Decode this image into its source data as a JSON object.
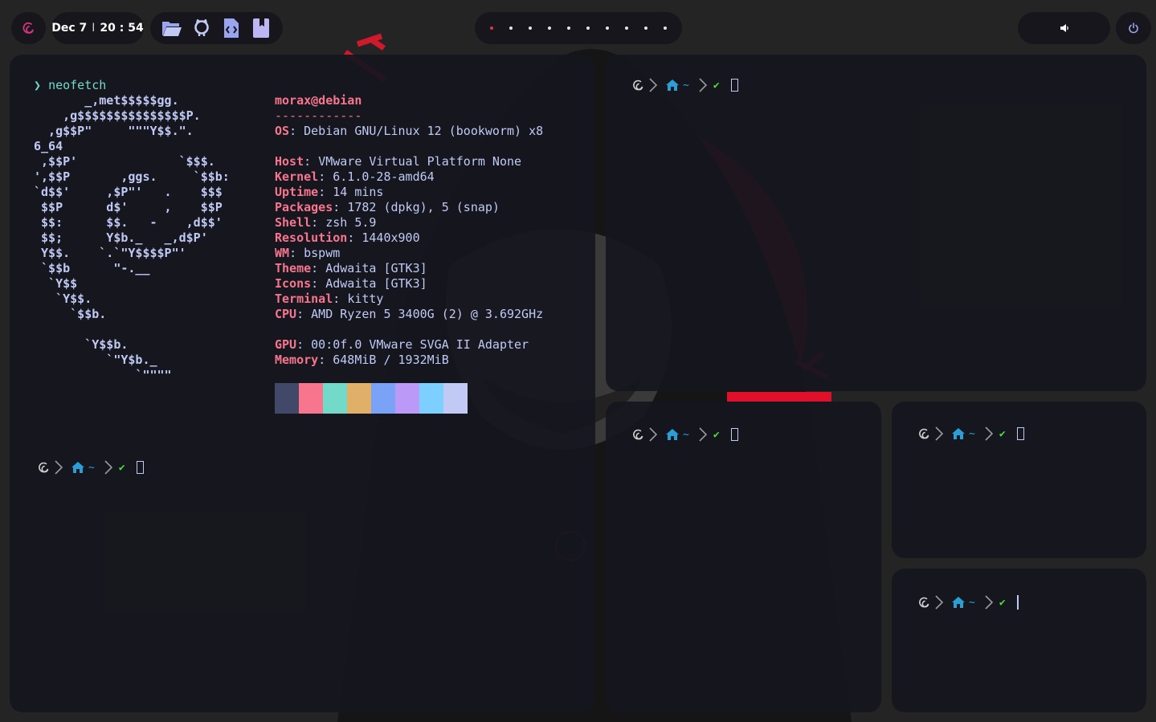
{
  "colors": {
    "accent": "#e0334e",
    "term_fg": "#c0caf5",
    "term_key": "#f7768e",
    "prompt_arrow": "#73daca",
    "home_blue": "#2a9fd6",
    "check_green": "#4ade39"
  },
  "topbar": {
    "logo_icon": "debian-swirl-icon",
    "clock": {
      "date": "Dec 7",
      "separator": "I",
      "time": "20 : 54"
    },
    "apps": [
      {
        "name": "file-manager",
        "icon": "folder-open-icon"
      },
      {
        "name": "github",
        "icon": "github-icon"
      },
      {
        "name": "code-editor",
        "icon": "code-file-icon"
      },
      {
        "name": "notes",
        "icon": "bookmark-icon"
      }
    ],
    "workspaces": {
      "count": 10,
      "active_index": 0
    },
    "volume_icon": "speaker-icon",
    "power_icon": "power-icon"
  },
  "main_terminal": {
    "command_prompt": "❯",
    "command": "neofetch",
    "ascii_art": [
      "       _,met$$$$$gg.",
      "    ,g$$$$$$$$$$$$$$$P.",
      "  ,g$$P\"     \"\"\"Y$$.\".",
      "6_64",
      " ,$$P'              `$$$.",
      "',$$P       ,ggs.     `$$b:",
      "`d$$'     ,$P\"'   .    $$$",
      " $$P      d$'     ,    $$P",
      " $$:      $$.   -    ,d$$'",
      " $$;      Y$b._   _,d$P'",
      " Y$$.    `.`\"Y$$$$P\"'",
      " `$$b      \"-.__",
      "  `Y$$",
      "   `Y$$.",
      "     `$$b.",
      "",
      "       `Y$$b.",
      "          `\"Y$b._",
      "              `\"\"\"\""
    ],
    "neofetch": {
      "user_host": "morax@debian",
      "underline": "------------",
      "fields": [
        {
          "key": "OS",
          "value": "Debian GNU/Linux 12 (bookworm) x8"
        },
        {
          "key": "",
          "value": ""
        },
        {
          "key": "Host",
          "value": "VMware Virtual Platform None"
        },
        {
          "key": "Kernel",
          "value": "6.1.0-28-amd64"
        },
        {
          "key": "Uptime",
          "value": "14 mins"
        },
        {
          "key": "Packages",
          "value": "1782 (dpkg), 5 (snap)"
        },
        {
          "key": "Shell",
          "value": "zsh 5.9"
        },
        {
          "key": "Resolution",
          "value": "1440x900"
        },
        {
          "key": "WM",
          "value": "bspwm"
        },
        {
          "key": "Theme",
          "value": "Adwaita [GTK3]"
        },
        {
          "key": "Icons",
          "value": "Adwaita [GTK3]"
        },
        {
          "key": "Terminal",
          "value": "kitty"
        },
        {
          "key": "CPU",
          "value": "AMD Ryzen 5 3400G (2) @ 3.692GHz"
        },
        {
          "key": "",
          "value": ""
        },
        {
          "key": "GPU",
          "value": "00:0f.0 VMware SVGA II Adapter"
        },
        {
          "key": "Memory",
          "value": "648MiB / 1932MiB"
        }
      ],
      "palette": [
        "#414868",
        "#f7768e",
        "#73daca",
        "#e0af68",
        "#7aa2f7",
        "#bb9af7",
        "#7dcfff",
        "#c0caf5"
      ]
    }
  },
  "prompt": {
    "os_icon": "debian-swirl-icon",
    "home_icon": "home-icon",
    "dir": "~",
    "status": "✔"
  }
}
